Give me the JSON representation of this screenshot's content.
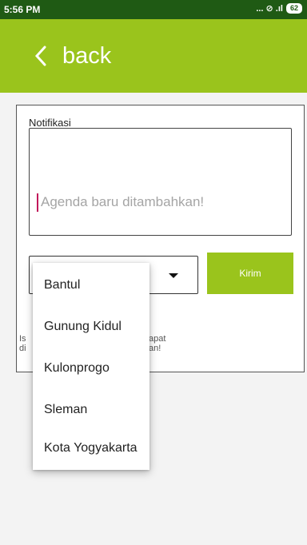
{
  "status_bar": {
    "time": "5:56 PM",
    "signal_glyphs": "... ⊘ .ıl",
    "battery_level": "62"
  },
  "app_bar": {
    "back_label": "back",
    "back_icon": "chevron-left-icon"
  },
  "form": {
    "title": "Notifikasi",
    "message_placeholder": "Agenda baru ditambahkan!",
    "region_select": {
      "selected_value": "",
      "options": [
        "Bantul",
        "Gunung Kidul",
        "Kulonprogo",
        "Sleman",
        "Kota Yogyakarta"
      ]
    },
    "send_label": "Kirim",
    "hint_fragment_left": "Is\ndi",
    "hint_fragment_right": "apat\nan!"
  },
  "colors": {
    "status_bar": "#1f5a14",
    "primary": "#9ac41c",
    "caret": "#c2185b"
  }
}
